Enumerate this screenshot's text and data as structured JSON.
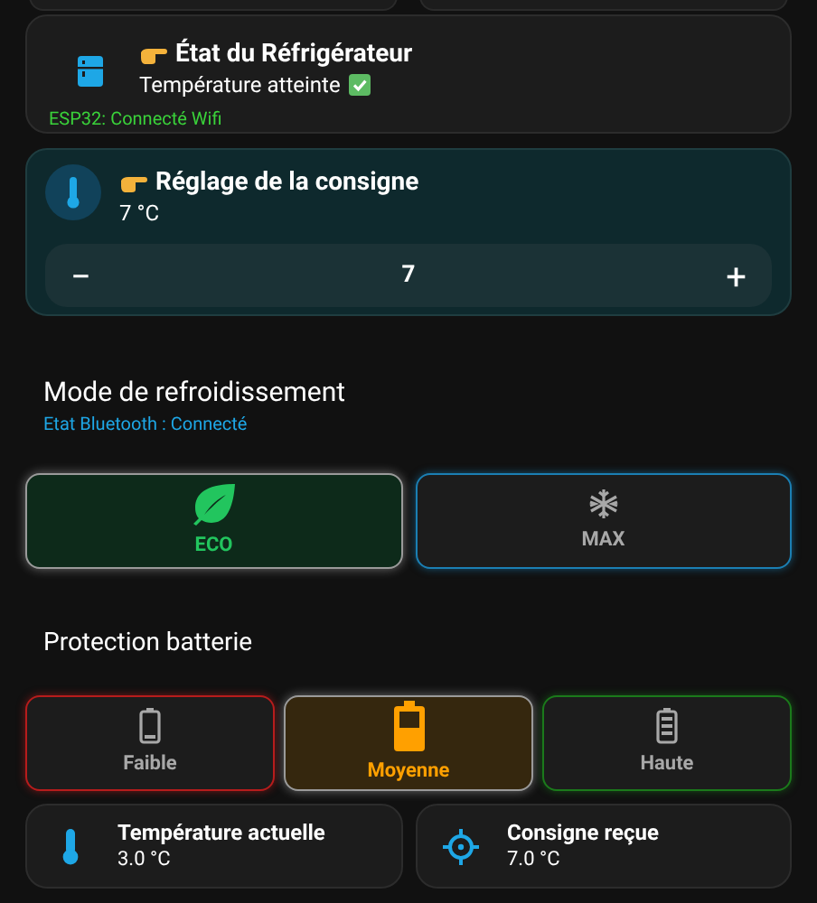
{
  "fridge_card": {
    "title": "État du Réfrigérateur",
    "state": "Température atteinte",
    "status": "ESP32: Connecté Wifi"
  },
  "setpoint_card": {
    "title": "Réglage de la consigne",
    "value": "7 °C",
    "stepper": {
      "minus": "−",
      "value": "7",
      "plus": "+"
    }
  },
  "cooling_mode": {
    "heading": "Mode de refroidissement",
    "status": "Etat Bluetooth : Connecté",
    "options": [
      {
        "label": "ECO",
        "kind": "leaf",
        "color": "#22c55e",
        "selected": true
      },
      {
        "label": "MAX",
        "kind": "snowflake",
        "color": "#1b7fb3",
        "selected": false
      }
    ]
  },
  "battery_protection": {
    "heading": "Protection batterie",
    "options": [
      {
        "label": "Faible",
        "kind": "low",
        "color": "#b71c1c",
        "selected": false
      },
      {
        "label": "Moyenne",
        "kind": "medium",
        "color": "#ffa000",
        "selected": true
      },
      {
        "label": "Haute",
        "kind": "high",
        "color": "#1b7a1b",
        "selected": false
      }
    ]
  },
  "sensors": [
    {
      "kind": "thermometer",
      "title": "Température actuelle",
      "value": "3.0 °C"
    },
    {
      "kind": "target",
      "title": "Consigne reçue",
      "value": "7.0 °C"
    }
  ]
}
